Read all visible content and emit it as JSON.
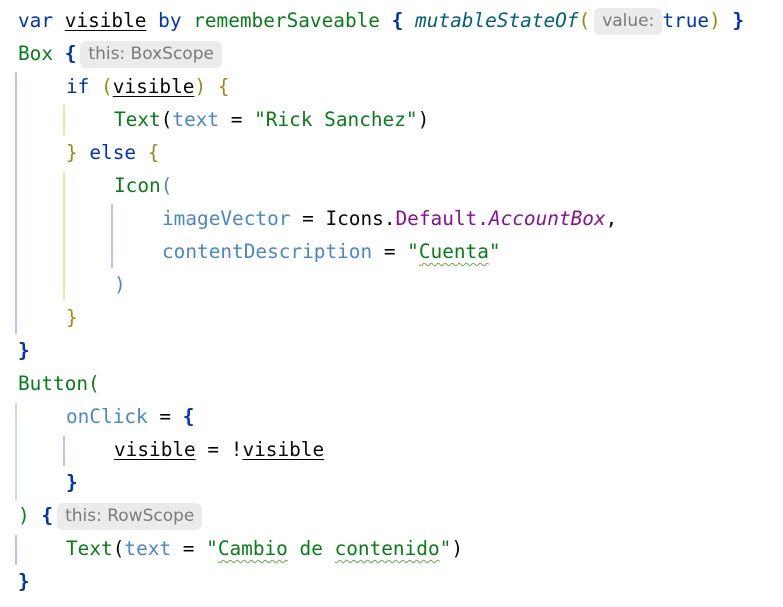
{
  "code": {
    "l1": {
      "kw_var": "var",
      "name": "visible",
      "kw_by": "by",
      "fn": "rememberSaveable",
      "brace": "{",
      "call": "mutableStateOf",
      "lp": "(",
      "hint": "value:",
      "val": "true",
      "rp": ")",
      "rbrace": "}"
    },
    "l2": {
      "call": "Box",
      "brace": "{",
      "hint": "this: BoxScope"
    },
    "l3": {
      "kw": "if",
      "lp": "(",
      "var": "visible",
      "rp": ")",
      "brace": "{"
    },
    "l4": {
      "call": "Text",
      "lp": "(",
      "param": "text",
      "eq": " = ",
      "str": "\"Rick Sanchez\"",
      "rp": ")"
    },
    "l5": {
      "rbrace": "}",
      "kw": "else",
      "brace": "{"
    },
    "l6": {
      "call": "Icon",
      "lp": "("
    },
    "l7": {
      "param": "imageVector",
      "eq": " = ",
      "obj": "Icons.",
      "prop": "Default.",
      "item": "AccountBox",
      "comma": ","
    },
    "l8": {
      "param": "contentDescription",
      "eq": " = ",
      "q1": "\"",
      "str": "Cuenta",
      "q2": "\""
    },
    "l9": {
      "rp": ")"
    },
    "l10": {
      "rbrace": "}"
    },
    "l11": {
      "rbrace": "}"
    },
    "l12": {
      "call": "Button",
      "lp": "("
    },
    "l13": {
      "param": "onClick",
      "eq": " = ",
      "brace": "{"
    },
    "l14": {
      "var1": "visible",
      "op": " = !",
      "var2": "visible"
    },
    "l15": {
      "rbrace": "}"
    },
    "l16": {
      "rp": ")",
      "brace": "{",
      "hint": "this: RowScope"
    },
    "l17": {
      "call": "Text",
      "lp": "(",
      "param": "text",
      "eq": " = ",
      "q1": "\"",
      "w1": "Cambio",
      "s1": " de ",
      "w2": "contenido",
      "q2": "\"",
      "rp": ")"
    },
    "l18": {
      "rbrace": "}"
    }
  },
  "colors": {
    "keyword": "#0033b3",
    "function": "#00627a",
    "call": "#067d17",
    "string": "#067d17",
    "param": "#4a86c8",
    "property": "#871094"
  }
}
